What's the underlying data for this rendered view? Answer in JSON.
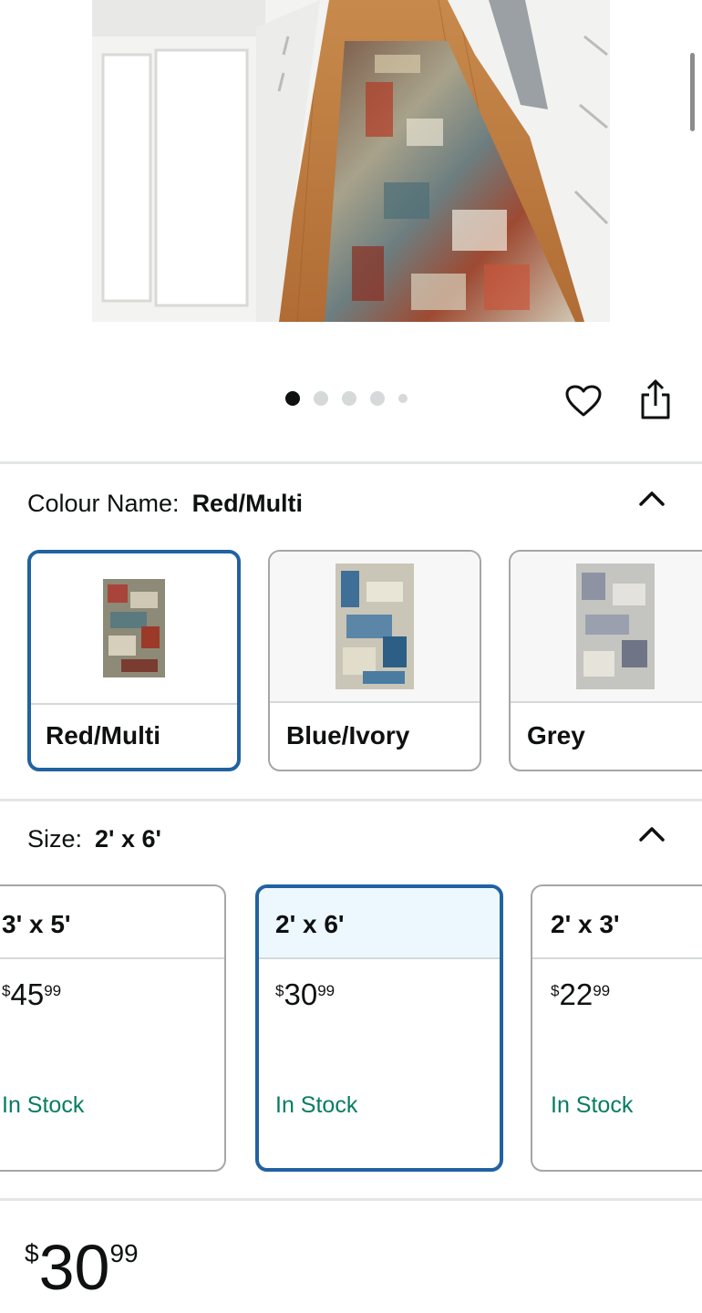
{
  "product": {
    "image_alt": "Multicolour abstract runner rug in a kitchen",
    "carousel": {
      "count": 5,
      "active_index": 0
    }
  },
  "actions": {
    "favorite_icon": "heart-icon",
    "share_icon": "share-icon"
  },
  "colour": {
    "label": "Colour Name:",
    "selected": "Red/Multi",
    "collapse_icon": "chevron-up-icon",
    "options": [
      {
        "name": "Red/Multi",
        "selected": true
      },
      {
        "name": "Blue/Ivory",
        "selected": false
      },
      {
        "name": "Grey",
        "selected": false
      }
    ]
  },
  "size": {
    "label": "Size:",
    "selected": "2' x 6'",
    "collapse_icon": "chevron-up-icon",
    "options": [
      {
        "size": "3' x 5'",
        "currency": "$",
        "whole": "45",
        "fraction": "99",
        "stock": "In Stock",
        "selected": false
      },
      {
        "size": "2' x 6'",
        "currency": "$",
        "whole": "30",
        "fraction": "99",
        "stock": "In Stock",
        "selected": true
      },
      {
        "size": "2' x 3'",
        "currency": "$",
        "whole": "22",
        "fraction": "99",
        "stock": "In Stock",
        "selected": false
      }
    ]
  },
  "price": {
    "currency": "$",
    "whole": "30",
    "fraction": "99"
  },
  "colors": {
    "selected_border": "#2162a1",
    "in_stock": "#067d62",
    "selected_header": "#edf7fe"
  }
}
